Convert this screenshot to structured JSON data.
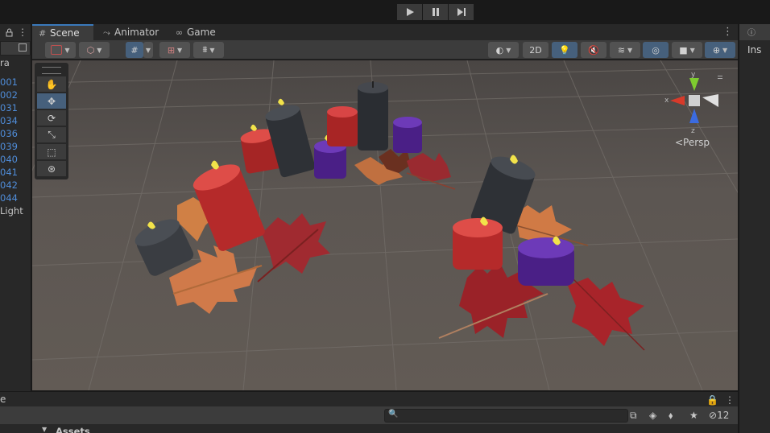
{
  "playbar": {
    "buttons": [
      {
        "icon": "play-icon"
      },
      {
        "icon": "pause-icon"
      },
      {
        "icon": "step-icon"
      }
    ]
  },
  "hierarchy": {
    "items": [
      {
        "label": "ra",
        "color": "plain"
      },
      {
        "label": "",
        "color": "gap"
      },
      {
        "label": "001",
        "color": "blue"
      },
      {
        "label": "002",
        "color": "blue"
      },
      {
        "label": "031",
        "color": "blue"
      },
      {
        "label": "034",
        "color": "blue"
      },
      {
        "label": "036",
        "color": "blue"
      },
      {
        "label": "039",
        "color": "blue"
      },
      {
        "label": "040",
        "color": "blue"
      },
      {
        "label": "041",
        "color": "blue"
      },
      {
        "label": "042",
        "color": "blue"
      },
      {
        "label": "044",
        "color": "blue"
      },
      {
        "label": "Light",
        "color": "plain"
      }
    ]
  },
  "scene": {
    "tabs": [
      {
        "label": "Scene",
        "icon": "grid-icon",
        "active": true
      },
      {
        "label": "Animator",
        "icon": "animator-icon",
        "active": false
      },
      {
        "label": "Game",
        "icon": "gamepad-icon",
        "active": false
      }
    ],
    "toolbar": {
      "mode_2d": "2D"
    },
    "view_label": "<Persp",
    "gizmo": {
      "y": "y",
      "x": "x",
      "z": "z"
    }
  },
  "inspector": {
    "tab_label": "Ins"
  },
  "project": {
    "tab_label": "e",
    "breadcrumb": "Assets",
    "hidden_count": "12"
  },
  "colors": {
    "accent": "#3a79bb",
    "toolbar_active": "#46607c",
    "panel": "#3c3c3c",
    "panel_dark": "#282828",
    "link_blue": "#4f8cd8"
  }
}
